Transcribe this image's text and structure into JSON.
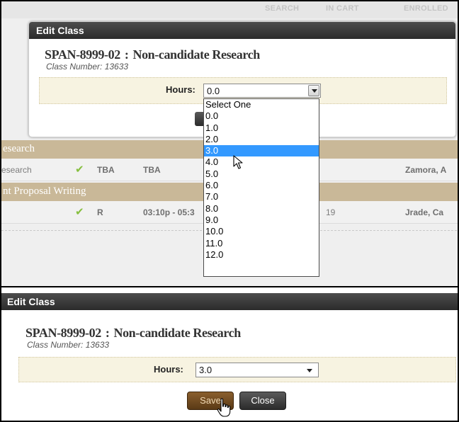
{
  "background": {
    "header_columns": [
      "SEARCH",
      "IN CART",
      "ENROLLED"
    ],
    "sections": [
      {
        "title": "esearch",
        "row": {
          "name": "esearch",
          "days": "TBA",
          "time": "TBA",
          "date": "",
          "instructor": "Zamora, A"
        }
      },
      {
        "title": "nt Proposal Writing",
        "row": {
          "name": "",
          "days": "R",
          "time": "03:10p - 05:3",
          "date": "19",
          "instructor": "Jrade, Ca"
        }
      }
    ]
  },
  "dialog_top": {
    "title": "Edit Class",
    "course_code": "SPAN-8999-02",
    "separator": ":",
    "course_title": "Non-candidate Research",
    "class_number": "Class Number: 13633",
    "hours_label": "Hours:",
    "hours_value": "0.0",
    "options": [
      "Select One",
      "0.0",
      "1.0",
      "2.0",
      "3.0",
      "4.0",
      "5.0",
      "6.0",
      "7.0",
      "8.0",
      "9.0",
      "10.0",
      "11.0",
      "12.0"
    ],
    "highlighted_option": "3.0"
  },
  "dialog_bottom": {
    "title": "Edit Class",
    "course_code": "SPAN-8999-02",
    "separator": ":",
    "course_title": "Non-candidate Research",
    "class_number": "Class Number: 13633",
    "hours_label": "Hours:",
    "hours_value": "3.0",
    "save_label": "Save",
    "close_label": "Close"
  },
  "colors": {
    "titlebar": "#2b2b2b",
    "section_bar": "#c9b898",
    "hours_box": "#f7f3e1",
    "highlight": "#3399ff",
    "save_button": "#6b4720",
    "check": "#86bf3f"
  },
  "icons": {
    "status": "checkmark-icon",
    "dropdown": "chevron-down-icon",
    "pointer": "arrow-cursor-icon",
    "hand": "hand-cursor-icon"
  }
}
